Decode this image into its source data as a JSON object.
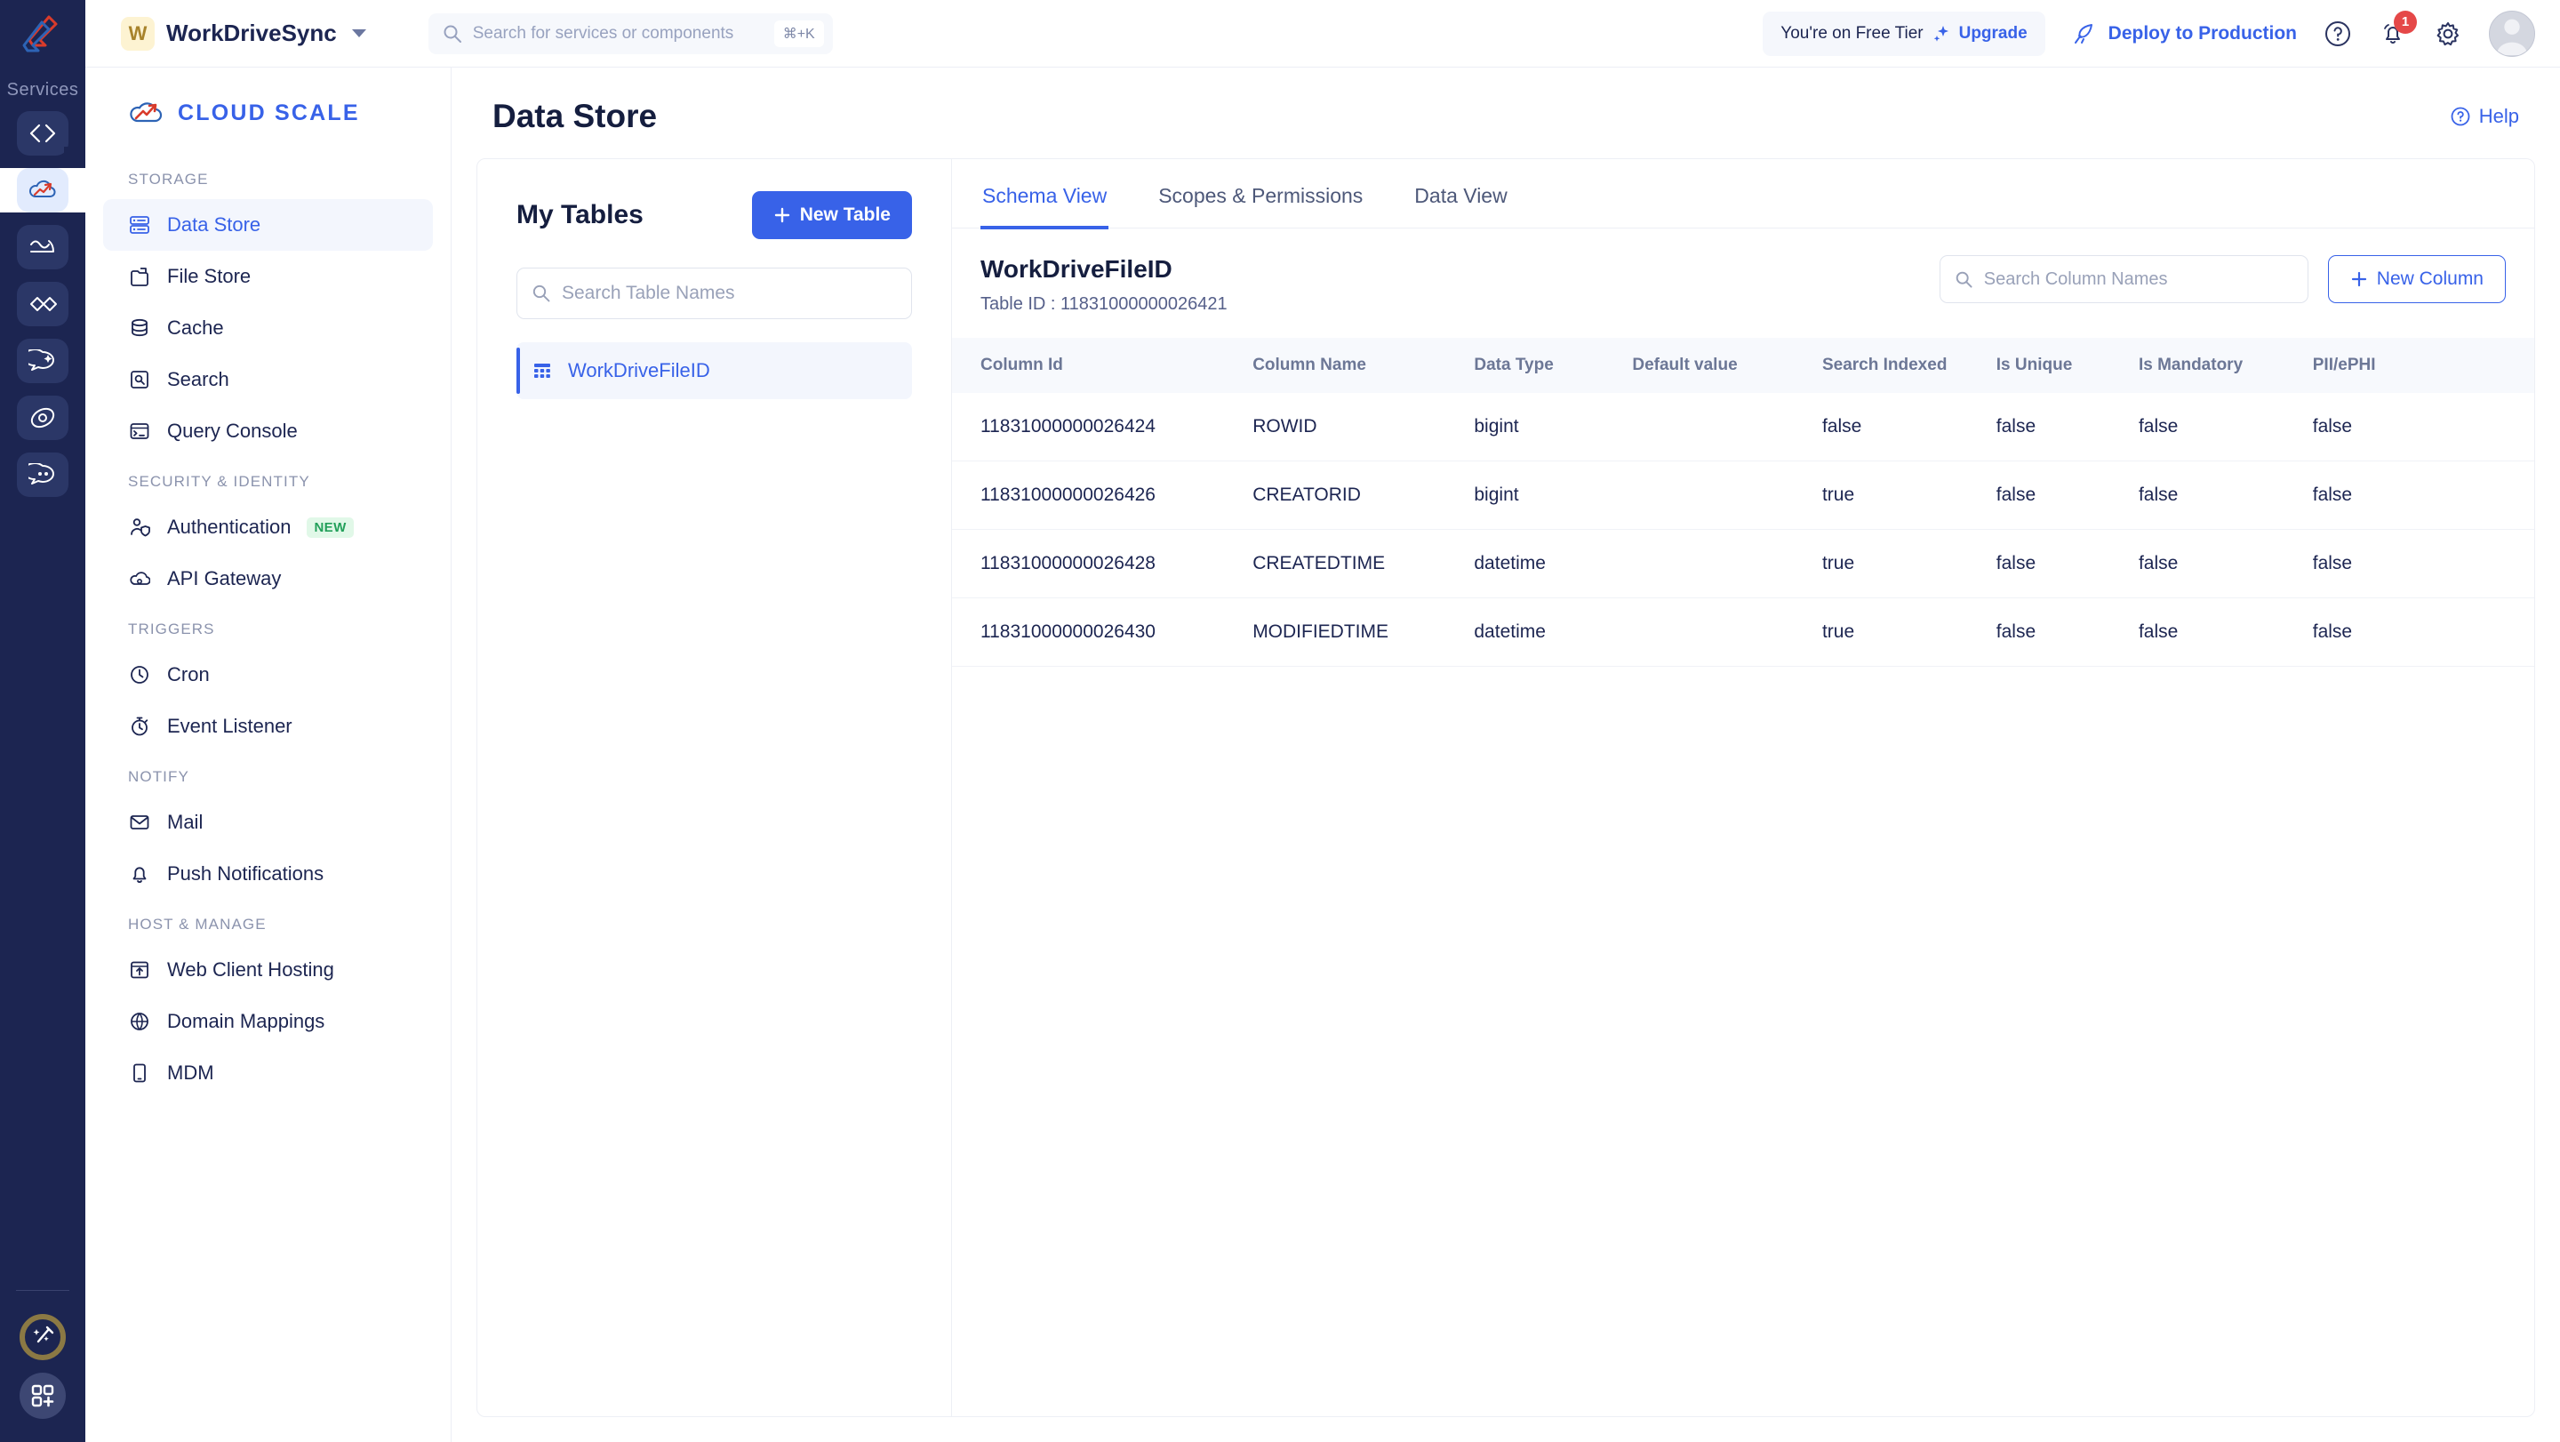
{
  "colors": {
    "accent": "#3862e8",
    "rail_bg": "#1c2551",
    "text_dark": "#1c2551",
    "badge_red": "#e54848",
    "badge_green": "#22a05a",
    "gold": "#8b7944"
  },
  "rail": {
    "label": "Services",
    "items": [
      {
        "name": "code-icon"
      },
      {
        "name": "cloud-scale-icon",
        "active": true
      },
      {
        "name": "analytics-icon"
      },
      {
        "name": "flow-icon"
      },
      {
        "name": "chat-ai-icon"
      },
      {
        "name": "orbit-icon"
      },
      {
        "name": "catalyst-chat-icon"
      }
    ],
    "bottom": [
      {
        "name": "magic-wand-icon"
      },
      {
        "name": "add-apps-icon"
      }
    ]
  },
  "topbar": {
    "project_initial": "W",
    "project_name": "WorkDriveSync",
    "search_placeholder": "Search for services or components",
    "search_shortcut": "⌘+K",
    "tier_text": "You're on Free Tier",
    "upgrade_label": "Upgrade",
    "deploy_label": "Deploy to Production",
    "notification_count": "1",
    "icons": {
      "help": "help-circle-icon",
      "bell": "bell-icon",
      "settings": "gear-icon",
      "avatar": "user-avatar"
    }
  },
  "sidebar": {
    "brand": "CLOUD SCALE",
    "groups": [
      {
        "title": "STORAGE",
        "items": [
          {
            "label": "Data Store",
            "icon": "database-rows-icon",
            "active": true
          },
          {
            "label": "File Store",
            "icon": "folder-upload-icon",
            "active": false
          },
          {
            "label": "Cache",
            "icon": "database-stack-icon",
            "active": false
          },
          {
            "label": "Search",
            "icon": "search-box-icon",
            "active": false
          },
          {
            "label": "Query Console",
            "icon": "terminal-icon",
            "active": false
          }
        ]
      },
      {
        "title": "SECURITY & IDENTITY",
        "items": [
          {
            "label": "Authentication",
            "icon": "user-shield-icon",
            "active": false,
            "badge": "NEW"
          },
          {
            "label": "API Gateway",
            "icon": "cloud-gear-icon",
            "active": false
          }
        ]
      },
      {
        "title": "TRIGGERS",
        "items": [
          {
            "label": "Cron",
            "icon": "clock-icon",
            "active": false
          },
          {
            "label": "Event Listener",
            "icon": "stopwatch-icon",
            "active": false
          }
        ]
      },
      {
        "title": "NOTIFY",
        "items": [
          {
            "label": "Mail",
            "icon": "envelope-icon",
            "active": false
          },
          {
            "label": "Push Notifications",
            "icon": "bell-icon",
            "active": false
          }
        ]
      },
      {
        "title": "HOST & MANAGE",
        "items": [
          {
            "label": "Web Client Hosting",
            "icon": "window-upload-icon",
            "active": false
          },
          {
            "label": "Domain Mappings",
            "icon": "globe-icon",
            "active": false
          },
          {
            "label": "MDM",
            "icon": "mobile-device-icon",
            "active": false
          }
        ]
      }
    ]
  },
  "main": {
    "page_title": "Data Store",
    "help_label": "Help"
  },
  "tables_panel": {
    "title": "My Tables",
    "new_table_label": "New Table",
    "search_placeholder": "Search Table Names",
    "tables": [
      {
        "name": "WorkDriveFileID",
        "active": true
      }
    ]
  },
  "schema_panel": {
    "tabs": [
      {
        "label": "Schema View",
        "active": true
      },
      {
        "label": "Scopes & Permissions",
        "active": false
      },
      {
        "label": "Data View",
        "active": false
      }
    ],
    "table_name": "WorkDriveFileID",
    "table_id_label": "Table ID : 11831000000026421",
    "column_search_placeholder": "Search Column Names",
    "new_column_label": "New Column",
    "headers": [
      "Column Id",
      "Column Name",
      "Data Type",
      "Default value",
      "Search Indexed",
      "Is Unique",
      "Is Mandatory",
      "PII/ePHI"
    ],
    "rows": [
      {
        "column_id": "11831000000026424",
        "column_name": "ROWID",
        "data_type": "bigint",
        "default_value": "",
        "search_indexed": "false",
        "is_unique": "false",
        "is_mandatory": "false",
        "pii_ephi": "false"
      },
      {
        "column_id": "11831000000026426",
        "column_name": "CREATORID",
        "data_type": "bigint",
        "default_value": "",
        "search_indexed": "true",
        "is_unique": "false",
        "is_mandatory": "false",
        "pii_ephi": "false"
      },
      {
        "column_id": "11831000000026428",
        "column_name": "CREATEDTIME",
        "data_type": "datetime",
        "default_value": "",
        "search_indexed": "true",
        "is_unique": "false",
        "is_mandatory": "false",
        "pii_ephi": "false"
      },
      {
        "column_id": "11831000000026430",
        "column_name": "MODIFIEDTIME",
        "data_type": "datetime",
        "default_value": "",
        "search_indexed": "true",
        "is_unique": "false",
        "is_mandatory": "false",
        "pii_ephi": "false"
      }
    ]
  }
}
